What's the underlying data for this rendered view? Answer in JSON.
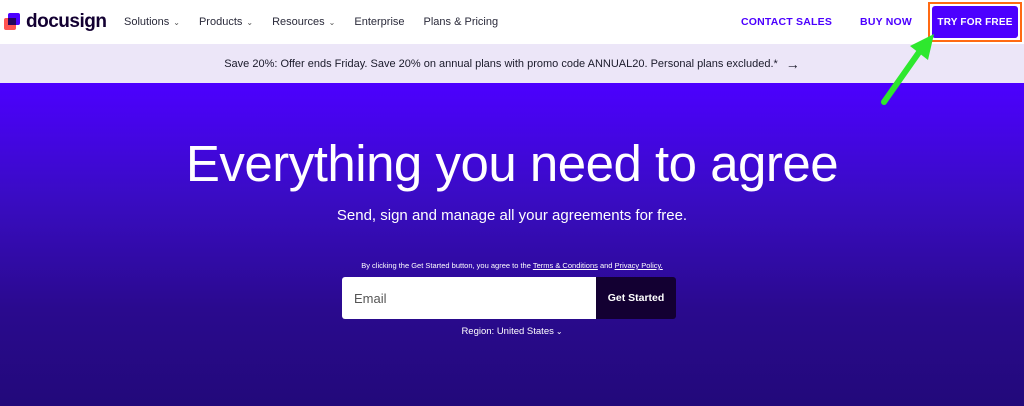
{
  "brand": {
    "name": "docusign"
  },
  "nav": {
    "links": [
      {
        "label": "Solutions",
        "has_menu": true
      },
      {
        "label": "Products",
        "has_menu": true
      },
      {
        "label": "Resources",
        "has_menu": true
      },
      {
        "label": "Enterprise",
        "has_menu": false
      },
      {
        "label": "Plans & Pricing",
        "has_menu": false
      }
    ],
    "contact_sales": "CONTACT SALES",
    "buy_now": "BUY NOW",
    "try_free": "TRY FOR FREE"
  },
  "promo": {
    "text": "Save 20%: Offer ends Friday. Save 20% on annual plans with promo code ANNUAL20. Personal plans excluded.*",
    "arrow_icon": "arrow-right-icon"
  },
  "hero": {
    "headline": "Everything you need to agree",
    "subheadline": "Send, sign and manage all your agreements for free.",
    "terms_prefix": "By clicking the Get Started button, you agree to the ",
    "terms_link": "Terms & Conditions",
    "terms_and": " and ",
    "privacy_link": "Privacy Policy.",
    "email_placeholder": "Email",
    "get_started": "Get Started",
    "region": "Region: United States"
  },
  "colors": {
    "brand_purple": "#4c00ff",
    "dark": "#130032",
    "promo_bg": "#ece6f8",
    "highlight_border": "#ff6a13",
    "annotation_arrow": "#2ee82e"
  }
}
